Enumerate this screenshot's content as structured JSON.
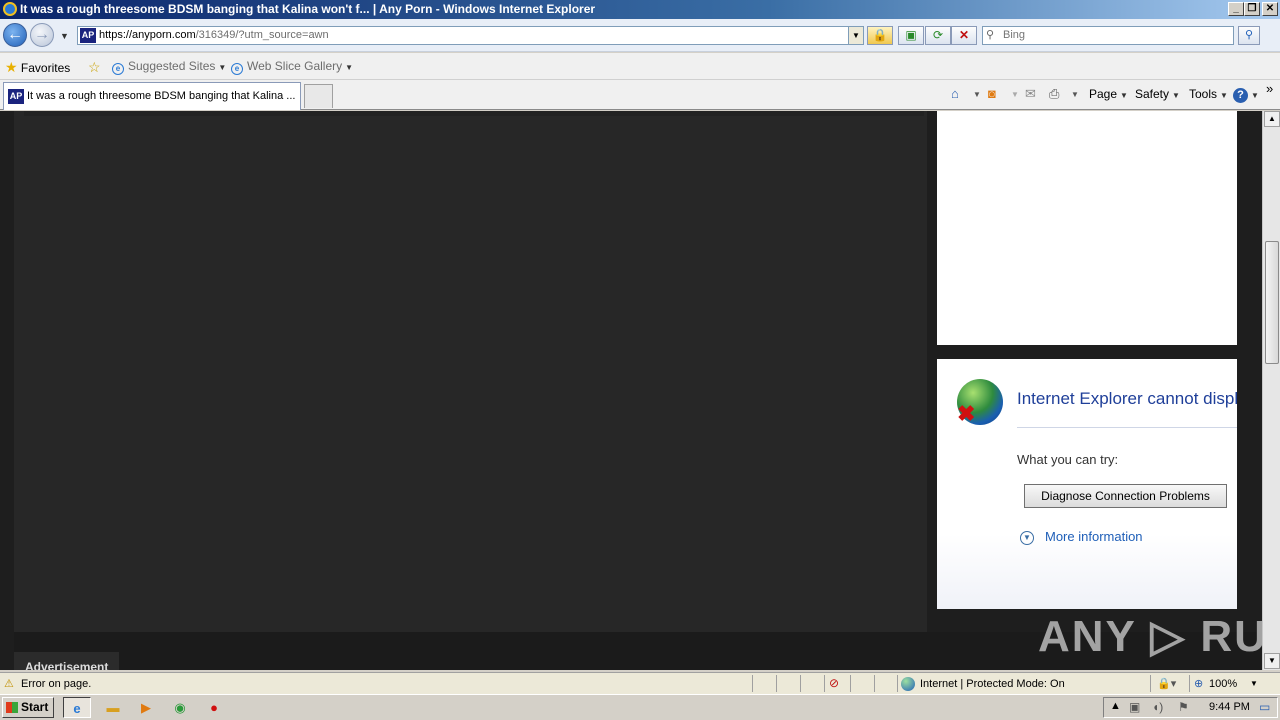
{
  "window": {
    "title": "It was a rough threesome BDSM banging that Kalina won't f... | Any Porn - Windows Internet Explorer",
    "controls": {
      "minimize": "_",
      "maximize": "❐",
      "close": "✕"
    }
  },
  "address_bar": {
    "favicon_text": "AP",
    "url_host": "https://anyporn.com",
    "url_path": "/316349/?utm_source=awn",
    "dropdown_glyph": "▼"
  },
  "toolbar_icons": [
    "lock-icon",
    "compatibility-view-icon",
    "refresh-icon",
    "stop-icon"
  ],
  "search": {
    "placeholder": "Bing",
    "go_glyph": "⚲"
  },
  "favorites_bar": {
    "favorites_label": "Favorites",
    "items": [
      {
        "label": "Suggested Sites"
      },
      {
        "label": "Web Slice Gallery"
      }
    ]
  },
  "tab": {
    "favicon_text": "AP",
    "title": "It was a rough threesome BDSM banging that Kalina ..."
  },
  "command_bar": {
    "page": "Page",
    "safety": "Safety",
    "tools": "Tools",
    "help_glyph": "?",
    "more_glyph": "»"
  },
  "error_panel": {
    "title": "Internet Explorer cannot display the webpage",
    "try_label": "What you can try:",
    "diagnose_button": "Diagnose Connection Problems",
    "more_info": "More information"
  },
  "ad_label": "Advertisement",
  "watermark": "ANY ▷ RUN",
  "status_bar": {
    "message": "Error on page.",
    "zone": "Internet | Protected Mode: On",
    "zoom": "100%"
  },
  "taskbar": {
    "start": "Start",
    "clock": "9:44 PM"
  },
  "colors": {
    "content_bg": "#1e1e1e",
    "video_bg": "#272727",
    "error_title": "#1f3f99",
    "link": "#1f5fb8"
  }
}
